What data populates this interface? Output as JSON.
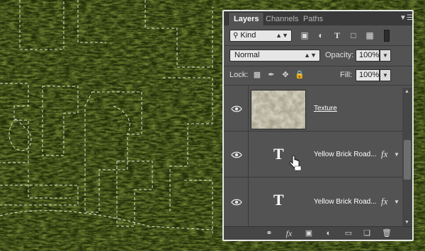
{
  "panel": {
    "tabs": [
      {
        "label": "Layers"
      },
      {
        "label": "Channels"
      },
      {
        "label": "Paths"
      }
    ],
    "menu_icon": "panel-menu-icon",
    "filter": {
      "value": "Kind",
      "icon": "search-icon"
    },
    "blend": {
      "value": "Normal"
    },
    "opacity": {
      "label": "Opacity:",
      "value": "100%"
    },
    "lock": {
      "label": "Lock:"
    },
    "fill": {
      "label": "Fill:",
      "value": "100%"
    },
    "layers": [
      {
        "name": "Texture",
        "kind": "image",
        "visible": true
      },
      {
        "name": "Yellow Brick Road...",
        "kind": "text",
        "visible": true,
        "has_fx": true,
        "type_glyph": "T",
        "fx_label": "fx"
      },
      {
        "name": "Yellow Brick Road...",
        "kind": "text",
        "visible": true,
        "has_fx": true,
        "type_glyph": "T",
        "fx_label": "fx"
      }
    ],
    "bottom_fx_label": "fx"
  },
  "colors": {
    "panel_bg": "#535353",
    "tabbar_bg": "#3a3a3a",
    "canvas_grass": "#3d4a12"
  }
}
